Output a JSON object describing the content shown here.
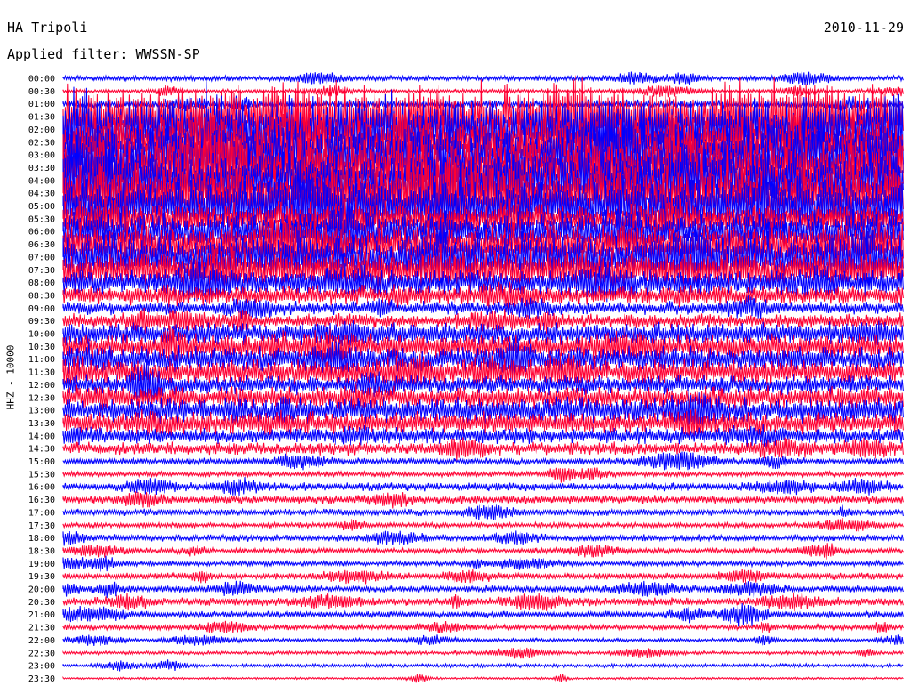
{
  "header": {
    "station": "HA Tripoli",
    "date": "2010-11-29",
    "filter": "Applied filter: WWSSN-SP"
  },
  "chart_data": {
    "type": "line",
    "title": "HA Tripoli",
    "ylabel": "HHZ - 10000",
    "colors": [
      "#0000ff",
      "#ff0033"
    ],
    "row_times": [
      "00:00",
      "00:30",
      "01:00",
      "01:30",
      "02:00",
      "02:30",
      "03:00",
      "03:30",
      "04:00",
      "04:30",
      "05:00",
      "05:30",
      "06:00",
      "06:30",
      "07:00",
      "07:30",
      "08:00",
      "08:30",
      "09:00",
      "09:30",
      "10:00",
      "10:30",
      "11:00",
      "11:30",
      "12:00",
      "12:30",
      "13:00",
      "13:30",
      "14:00",
      "14:30",
      "15:00",
      "15:30",
      "16:00",
      "16:30",
      "17:00",
      "17:30",
      "18:00",
      "18:30",
      "19:00",
      "19:30",
      "20:00",
      "20:30",
      "21:00",
      "21:30",
      "22:00",
      "22:30",
      "23:00",
      "23:30"
    ],
    "series": [
      {
        "values": [
          3,
          2,
          5,
          38,
          40,
          36,
          44,
          42,
          40,
          38,
          36,
          20,
          26,
          28,
          30,
          24,
          16,
          12,
          8,
          9,
          14,
          16,
          16,
          16,
          12,
          14,
          16,
          14,
          10,
          8,
          4,
          3,
          5,
          5,
          4,
          3,
          4,
          3,
          3,
          4,
          4,
          5,
          4,
          3,
          2,
          2,
          2,
          1
        ]
      }
    ],
    "grid": false
  }
}
